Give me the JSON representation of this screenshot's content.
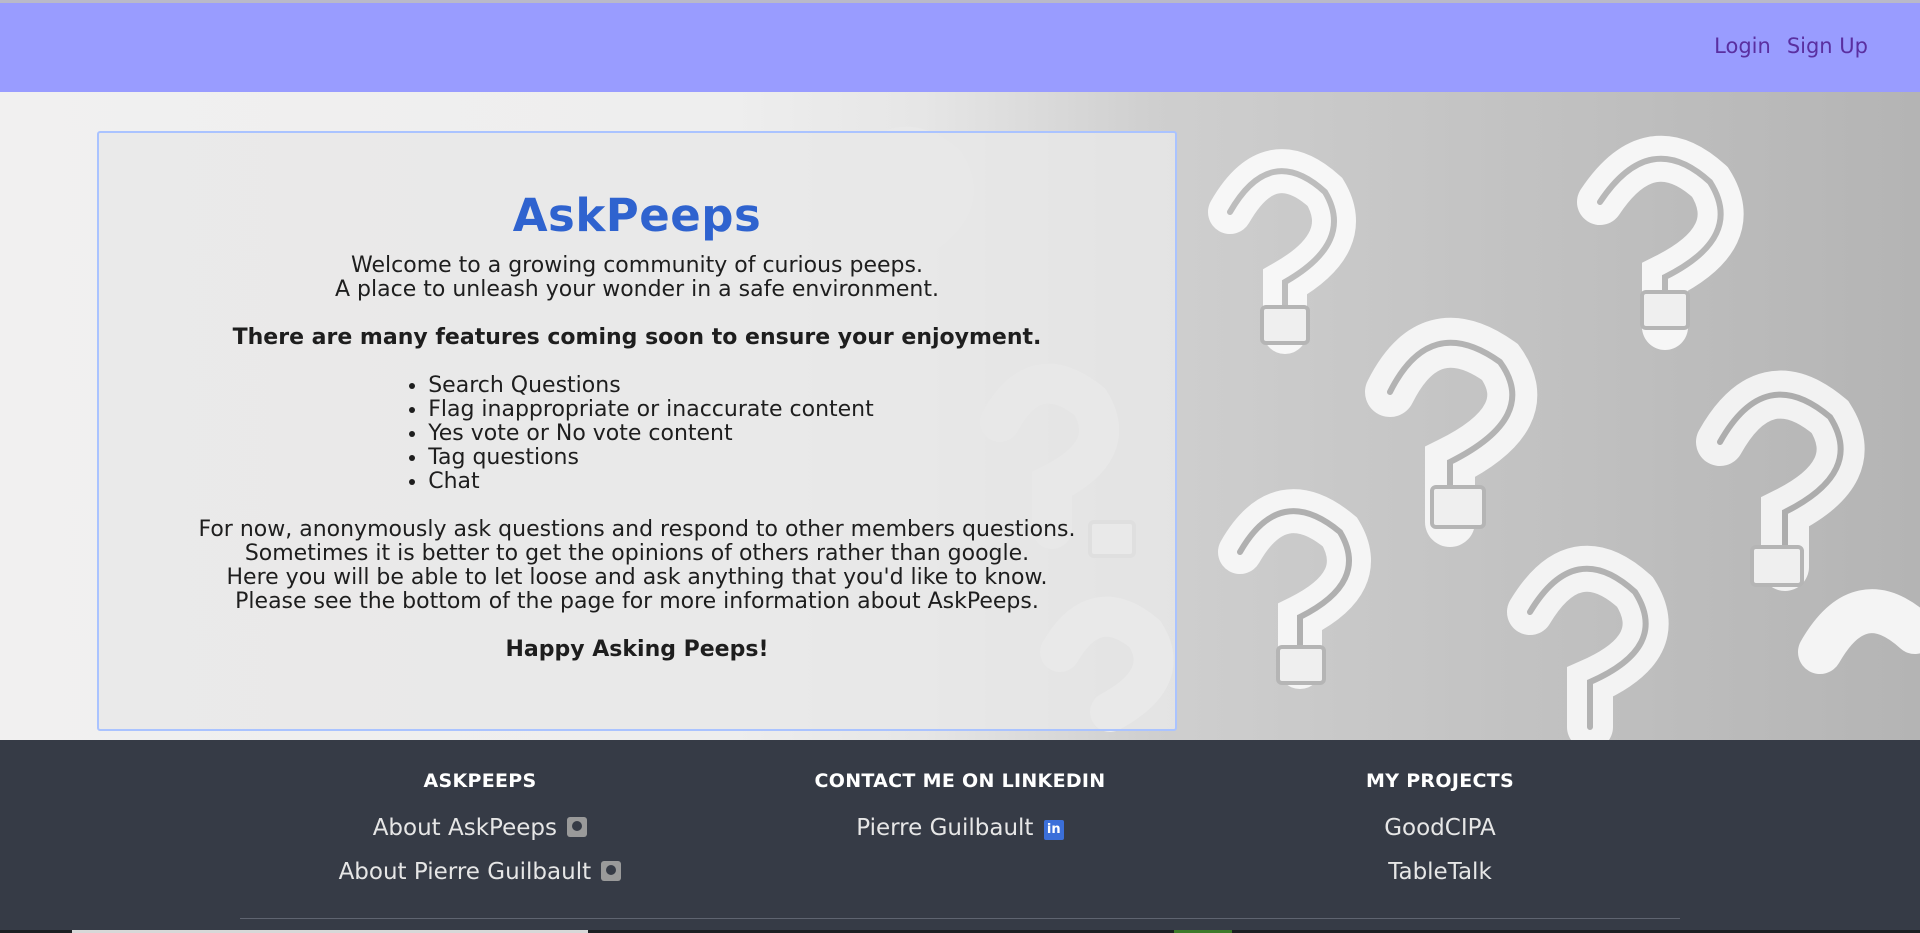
{
  "navbar": {
    "login_label": "Login",
    "signup_label": "Sign Up"
  },
  "card": {
    "title": "AskPeeps",
    "welcome_lines": [
      "Welcome to a growing community of curious peeps.",
      "A place to unleash your wonder in a safe environment."
    ],
    "features_heading": "There are many features coming soon to ensure your enjoyment.",
    "features": [
      "Search Questions",
      "Flag inappropriate or inaccurate content",
      "Yes vote or No vote content",
      "Tag questions",
      "Chat"
    ],
    "info_lines": [
      "For now, anonymously ask questions and respond to other members questions.",
      "Sometimes it is better to get the opinions of others rather than google.",
      "Here you will be able to let loose and ask anything that you'd like to know.",
      "Please see the bottom of the page for more information about AskPeeps."
    ],
    "closing": "Happy Asking Peeps!"
  },
  "footer": {
    "askpeeps": {
      "heading": "ASKPEEPS",
      "links": [
        "About AskPeeps",
        "About Pierre Guilbault"
      ]
    },
    "linkedin": {
      "heading": "CONTACT ME ON LINKEDIN",
      "links": [
        "Pierre Guilbault"
      ]
    },
    "projects": {
      "heading": "MY PROJECTS",
      "links": [
        "GoodCIPA",
        "TableTalk"
      ]
    }
  },
  "icons": {
    "github": "github-icon",
    "linkedin": "linkedin-icon"
  },
  "colors": {
    "navbar": "#999cff",
    "nav_link": "#5a2fa0",
    "title": "#2f63cf",
    "card_border": "#aac3ff",
    "footer": "#363b46",
    "linkedin_icon": "#3b6fd9"
  }
}
